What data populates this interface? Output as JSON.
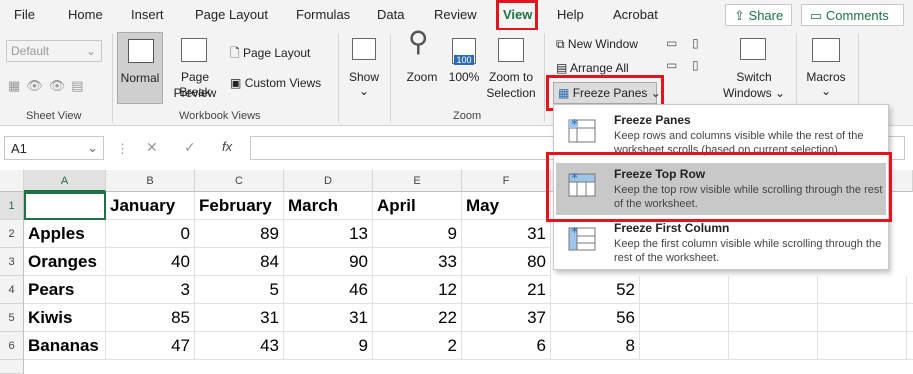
{
  "tabs": [
    "File",
    "Home",
    "Insert",
    "Page Layout",
    "Formulas",
    "Data",
    "Review",
    "View",
    "Help",
    "Acrobat"
  ],
  "share_label": "Share",
  "comments_label": "Comments",
  "ribbon": {
    "sheet_view": {
      "dropdown_value": "Default",
      "group_label": "Sheet View"
    },
    "workbook_views": {
      "normal": "Normal",
      "page_break_preview": [
        "Page Break",
        "Preview"
      ],
      "page_layout": "Page Layout",
      "custom_views": "Custom Views",
      "group_label": "Workbook Views"
    },
    "show": "Show",
    "zoom": {
      "zoom": "Zoom",
      "pct": "100%",
      "zoom_to_selection": [
        "Zoom to",
        "Selection"
      ],
      "icon_text": "100",
      "group_label": "Zoom"
    },
    "window": {
      "new_window": "New Window",
      "arrange_all": "Arrange All",
      "freeze_panes": "Freeze Panes",
      "switch_windows": [
        "Switch",
        "Windows"
      ]
    },
    "macros": "Macros"
  },
  "formula_bar": {
    "name_box": "A1",
    "fx": "fx"
  },
  "sheet": {
    "columns": [
      "A",
      "B",
      "C",
      "D",
      "E",
      "F"
    ],
    "rows": [
      "1",
      "2",
      "3",
      "4",
      "5",
      "6"
    ],
    "header": [
      "",
      "January",
      "February",
      "March",
      "April",
      "May"
    ],
    "data": [
      [
        "Apples",
        "0",
        "89",
        "13",
        "9",
        "31",
        ""
      ],
      [
        "Oranges",
        "40",
        "84",
        "90",
        "33",
        "80",
        ""
      ],
      [
        "Pears",
        "3",
        "5",
        "46",
        "12",
        "21",
        "52"
      ],
      [
        "Kiwis",
        "85",
        "31",
        "31",
        "22",
        "37",
        "56"
      ],
      [
        "Bananas",
        "47",
        "43",
        "9",
        "2",
        "6",
        "8"
      ]
    ]
  },
  "freeze_menu": [
    {
      "title": "Freeze Panes",
      "desc": "Keep rows and columns visible while the rest of the worksheet scrolls (based on current selection)."
    },
    {
      "title": "Freeze Top Row",
      "desc": "Keep the top row visible while scrolling through the rest of the worksheet."
    },
    {
      "title": "Freeze First Column",
      "desc": "Keep the first column visible while scrolling through the rest of the worksheet."
    }
  ],
  "colors": {
    "accent": "#1e7145",
    "highlight": "#e0161c"
  }
}
